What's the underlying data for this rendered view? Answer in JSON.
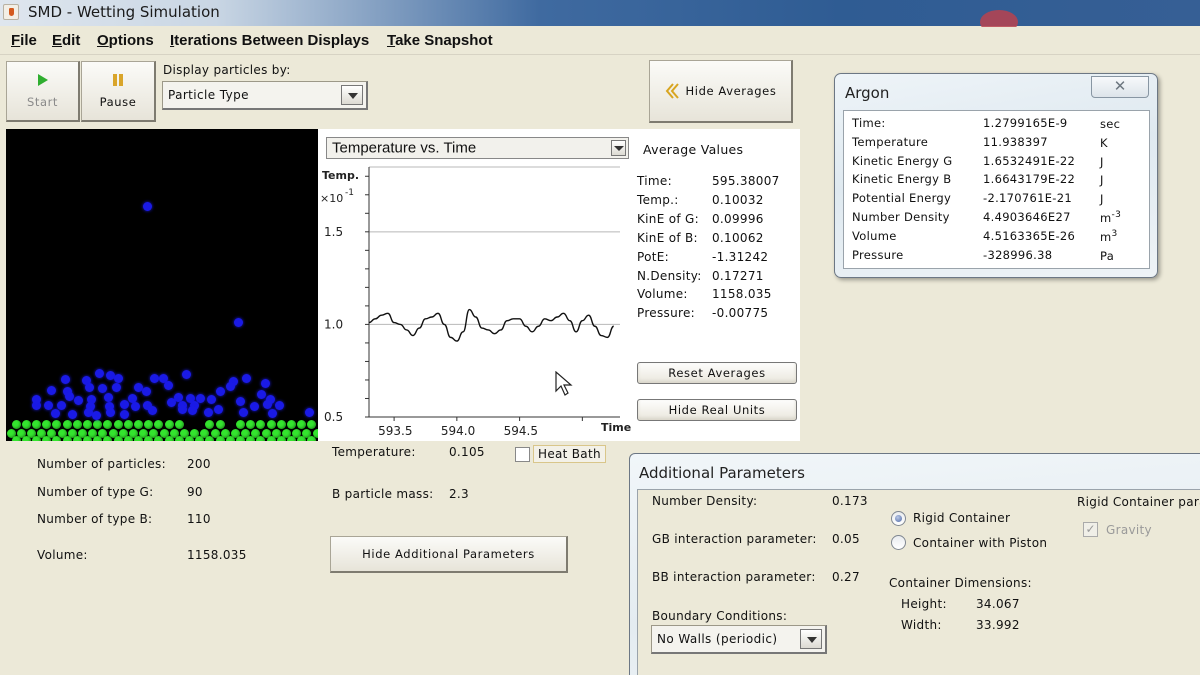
{
  "window": {
    "title": "SMD - Wetting Simulation"
  },
  "menu": [
    {
      "label": "File",
      "mnemonic": "F",
      "rest": "ile"
    },
    {
      "label": "Edit",
      "mnemonic": "E",
      "rest": "dit"
    },
    {
      "label": "Options",
      "mnemonic": "O",
      "rest": "ptions"
    },
    {
      "label": "Iterations Between Displays",
      "mnemonic": "I",
      "rest": "terations Between Displays"
    },
    {
      "label": "Take Snapshot",
      "mnemonic": "T",
      "rest": "ake Snapshot"
    }
  ],
  "toolbar": {
    "start_label": "Start",
    "pause_label": "Pause",
    "display_by_label": "Display particles by:",
    "display_by_value": "Particle Type",
    "hide_averages_label": "Hide Averages"
  },
  "colors": {
    "particle_g": "#34e52e",
    "particle_b": "#1a1ae6",
    "start_icon": "#2fae2f",
    "pause_icon": "#d9a52a",
    "chevron_icon": "#d8a520"
  },
  "simulation_info": {
    "num_particles_label": "Number of particles:",
    "num_particles": "200",
    "num_g_label": "Number of type G:",
    "num_g": "90",
    "num_b_label": "Number of type B:",
    "num_b": "110",
    "volume_label": "Volume:",
    "volume": "1158.035"
  },
  "graph": {
    "selected_plot": "Temperature vs. Time"
  },
  "chart_data": {
    "type": "line",
    "title": "Temperature vs. Time",
    "xlabel": "Time",
    "ylabel": "Temp.",
    "ylabel_multiplier": "×10",
    "ylabel_exponent": "-1",
    "xlim": [
      593.3,
      595.3
    ],
    "ylim": [
      0.5,
      1.85
    ],
    "x_ticks": [
      "593.5",
      "594.0",
      "594.5"
    ],
    "y_ticks": [
      "0.5",
      "1.0",
      "1.5"
    ],
    "grid_lines": [
      1.0,
      1.5,
      1.85
    ],
    "series": [
      {
        "name": "Temperature",
        "x": [
          593.3,
          593.35,
          593.4,
          593.45,
          593.5,
          593.55,
          593.6,
          593.65,
          593.7,
          593.75,
          593.8,
          593.85,
          593.9,
          593.95,
          594.0,
          594.05,
          594.1,
          594.15,
          594.2,
          594.25,
          594.3,
          594.35,
          594.4,
          594.45,
          594.5,
          594.55,
          594.6,
          594.65,
          594.7,
          594.75,
          594.8,
          594.85,
          594.9,
          594.95,
          595.0,
          595.05,
          595.1,
          595.15,
          595.2,
          595.25
        ],
        "y": [
          1.01,
          1.03,
          1.05,
          1.06,
          1.01,
          1.0,
          0.97,
          0.94,
          0.98,
          1.03,
          1.04,
          1.06,
          1.0,
          0.93,
          0.91,
          0.96,
          1.08,
          1.04,
          0.98,
          0.97,
          0.95,
          0.97,
          1.02,
          1.03,
          1.03,
          0.99,
          0.96,
          0.99,
          1.03,
          1.02,
          1.04,
          1.06,
          1.02,
          0.96,
          1.02,
          1.05,
          0.99,
          0.94,
          0.93,
          0.99
        ]
      }
    ]
  },
  "averages": {
    "title": "Average Values",
    "rows": [
      {
        "label": "Time:",
        "value": "595.38007"
      },
      {
        "label": "Temp.:",
        "value": "0.10032"
      },
      {
        "label": "KinE of G:",
        "value": "0.09996"
      },
      {
        "label": "KinE of B:",
        "value": "0.10062"
      },
      {
        "label": "PotE:",
        "value": "-1.31242"
      },
      {
        "label": "N.Density:",
        "value": "0.17271"
      },
      {
        "label": "Volume:",
        "value": "1158.035"
      },
      {
        "label": "Pressure:",
        "value": "-0.00775"
      }
    ],
    "reset_label": "Reset Averages",
    "hide_real_units_label": "Hide Real Units"
  },
  "controls": {
    "temperature_label": "Temperature:",
    "temperature_value": "0.105",
    "heat_bath_label": "Heat Bath",
    "heat_bath_checked": false,
    "b_mass_label": "B particle mass:",
    "b_mass_value": "2.3",
    "hide_additional_label": "Hide Additional Parameters"
  },
  "argon": {
    "title": "Argon",
    "close_glyph": "✕",
    "rows": [
      {
        "label": "Time:",
        "value": "1.2799165E-9",
        "unit": "sec",
        "exp": ""
      },
      {
        "label": "Temperature",
        "value": "11.938397",
        "unit": "K",
        "exp": ""
      },
      {
        "label": "Kinetic Energy G",
        "value": "1.6532491E-22",
        "unit": "J",
        "exp": ""
      },
      {
        "label": "Kinetic Energy B",
        "value": "1.6643179E-22",
        "unit": "J",
        "exp": ""
      },
      {
        "label": "Potential Energy",
        "value": "-2.170761E-21",
        "unit": "J",
        "exp": ""
      },
      {
        "label": "Number Density",
        "value": "4.4903646E27",
        "unit": "m",
        "exp": "-3"
      },
      {
        "label": "Volume",
        "value": "4.5163365E-26",
        "unit": "m",
        "exp": "3"
      },
      {
        "label": "Pressure",
        "value": "-328996.38",
        "unit": "Pa",
        "exp": ""
      }
    ]
  },
  "additional": {
    "title": "Additional Parameters",
    "number_density_label": "Number Density:",
    "number_density": "0.173",
    "gb_label": "GB interaction parameter:",
    "gb_value": "0.05",
    "bb_label": "BB interaction parameter:",
    "bb_value": "0.27",
    "boundary_label": "Boundary Conditions:",
    "boundary_value": "No Walls (periodic)",
    "rigid_label": "Rigid Container",
    "rigid_selected": true,
    "piston_label": "Container with Piston",
    "piston_selected": false,
    "dimensions_label": "Container Dimensions:",
    "height_label": "Height:",
    "height_value": "34.067",
    "width_label": "Width:",
    "width_value": "33.992",
    "rigid_params_label": "Rigid Container para",
    "gravity_label": "Gravity",
    "gravity_checked": true
  }
}
